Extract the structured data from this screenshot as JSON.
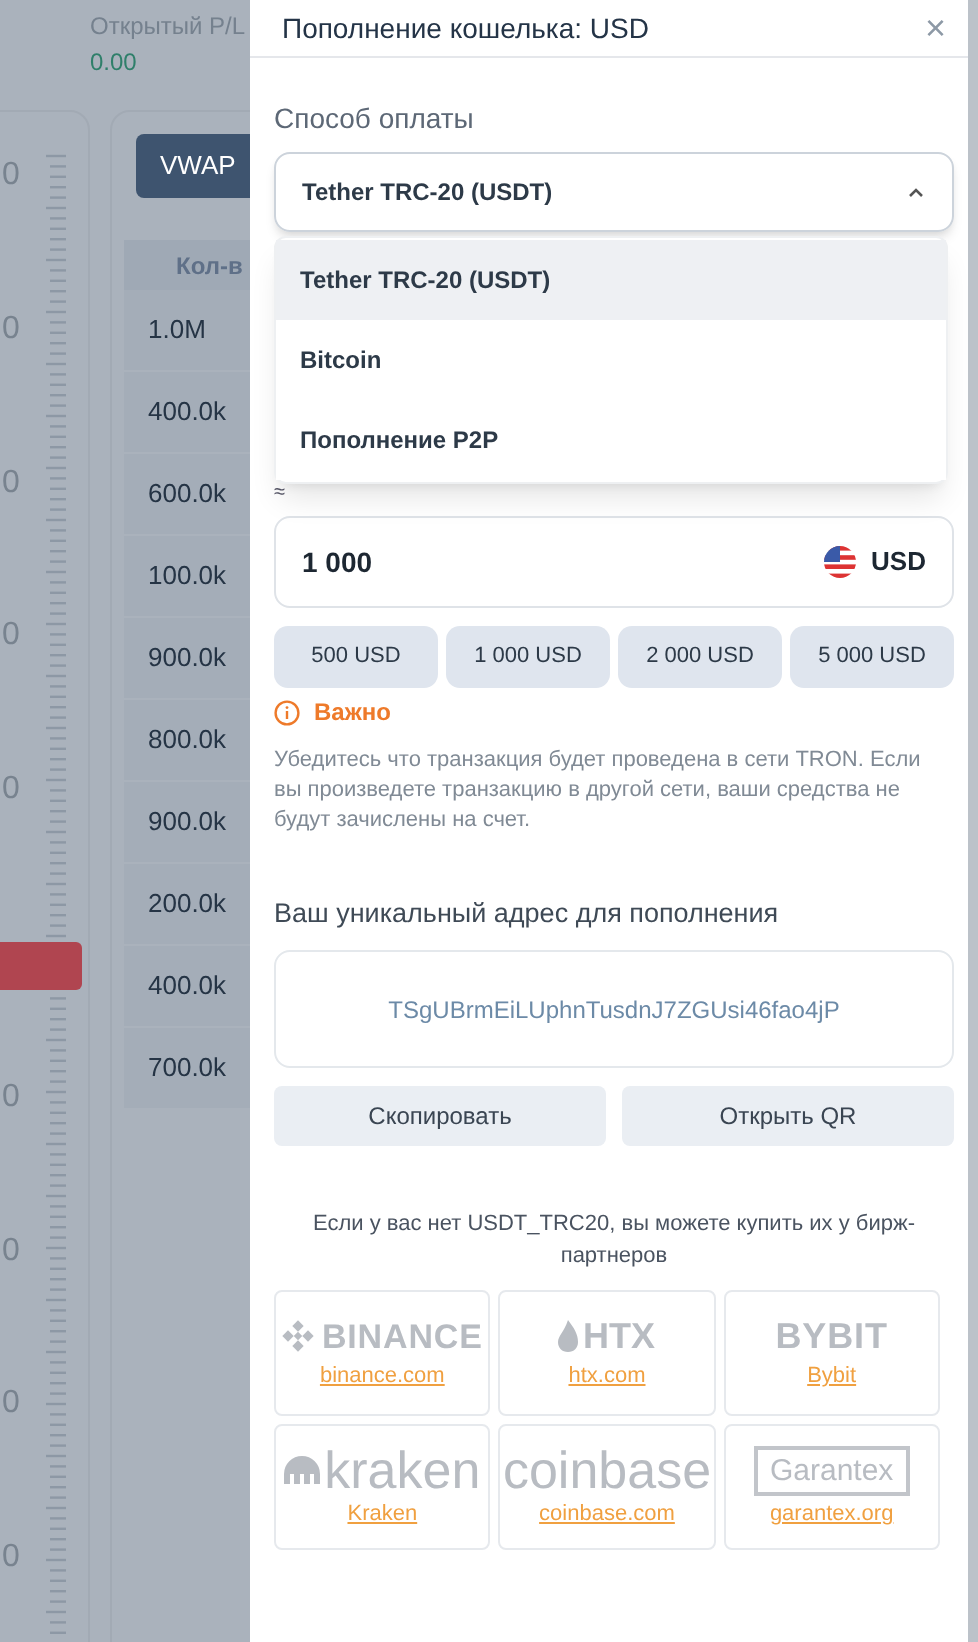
{
  "background": {
    "pl_label": "Открытый P/L",
    "pl_value": "0.00",
    "axis_labels": [
      "0",
      "0",
      "0",
      "0",
      "0",
      "0",
      "0",
      "0",
      "0"
    ],
    "vwap_button": "VWAP",
    "column_header": "Кол-в",
    "quantities": [
      "1.0M",
      "400.0k",
      "600.0k",
      "100.0k",
      "900.0k",
      "800.0k",
      "900.0k",
      "200.0k",
      "400.0k",
      "700.0k"
    ]
  },
  "modal": {
    "title": "Пополнение кошелька: USD",
    "close": "×",
    "payment_label": "Способ оплаты",
    "select": {
      "value": "Tether TRC-20 (USDT)",
      "expanded": true
    },
    "options": [
      {
        "label": "Tether TRC-20 (USDT)",
        "selected": true
      },
      {
        "label": "Bitcoin",
        "selected": false
      },
      {
        "label": "Пополнение P2P",
        "selected": false
      }
    ],
    "approx": "≈",
    "amount": {
      "value": "1 000",
      "currency": "USD"
    },
    "presets": [
      "500 USD",
      "1 000 USD",
      "2 000 USD",
      "5 000 USD"
    ],
    "warning_title": "Важно",
    "warning_text": "Убедитесь что транзакция будет проведена в сети TRON. Если вы произведете транзакцию в другой сети, ваши средства не будут зачислены на счет.",
    "address_heading": "Ваш уникальный адрес для пополнения",
    "address": "TSgUBrmEiLUphnTusdnJ7ZGUsi46fao4jP",
    "buttons": [
      "Скопировать",
      "Открыть QR"
    ],
    "partners_text": "Если у вас нет USDT_TRC20, вы можете купить их у бирж-партнеров",
    "partners": [
      {
        "kind": "binance",
        "logo": "BINANCE",
        "link": "binance.com"
      },
      {
        "kind": "htx",
        "logo": "HTX",
        "link": "htx.com"
      },
      {
        "kind": "bybit",
        "logo": "BYBIT",
        "link": "Bybit"
      },
      {
        "kind": "kraken",
        "logo": "kraken",
        "link": "Kraken"
      },
      {
        "kind": "coinbase",
        "logo": "coinbase",
        "link": "coinbase.com"
      },
      {
        "kind": "garantex",
        "logo": "Garantex",
        "link": "garantex.org"
      }
    ]
  }
}
